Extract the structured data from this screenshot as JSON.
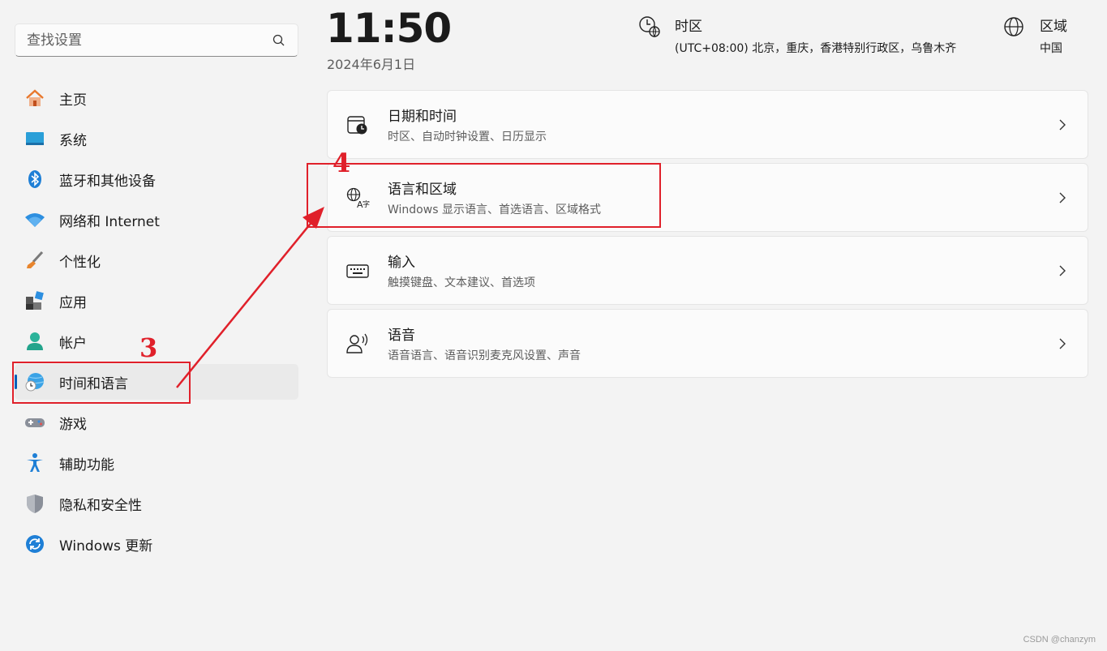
{
  "search": {
    "placeholder": "查找设置"
  },
  "sidebar": {
    "items": [
      {
        "label": "主页"
      },
      {
        "label": "系统"
      },
      {
        "label": "蓝牙和其他设备"
      },
      {
        "label": "网络和 Internet"
      },
      {
        "label": "个性化"
      },
      {
        "label": "应用"
      },
      {
        "label": "帐户"
      },
      {
        "label": "时间和语言",
        "active": true
      },
      {
        "label": "游戏"
      },
      {
        "label": "辅助功能"
      },
      {
        "label": "隐私和安全性"
      },
      {
        "label": "Windows 更新"
      }
    ]
  },
  "header": {
    "time": "11:50",
    "date": "2024年6月1日",
    "timezone": {
      "title": "时区",
      "value": "(UTC+08:00) 北京，重庆，香港特别行政区，乌鲁木齐"
    },
    "region": {
      "title": "区域",
      "value": "中国"
    }
  },
  "cards": [
    {
      "title": "日期和时间",
      "subtitle": "时区、自动时钟设置、日历显示"
    },
    {
      "title": "语言和区域",
      "subtitle": "Windows 显示语言、首选语言、区域格式"
    },
    {
      "title": "输入",
      "subtitle": "触摸键盘、文本建议、首选项"
    },
    {
      "title": "语音",
      "subtitle": "语音语言、语音识别麦克风设置、声音"
    }
  ],
  "annotations": {
    "step3": "3",
    "step4": "4"
  },
  "watermark": "CSDN @chanzym",
  "colors": {
    "accent": "#005fb8",
    "annotation": "#e0202a"
  }
}
